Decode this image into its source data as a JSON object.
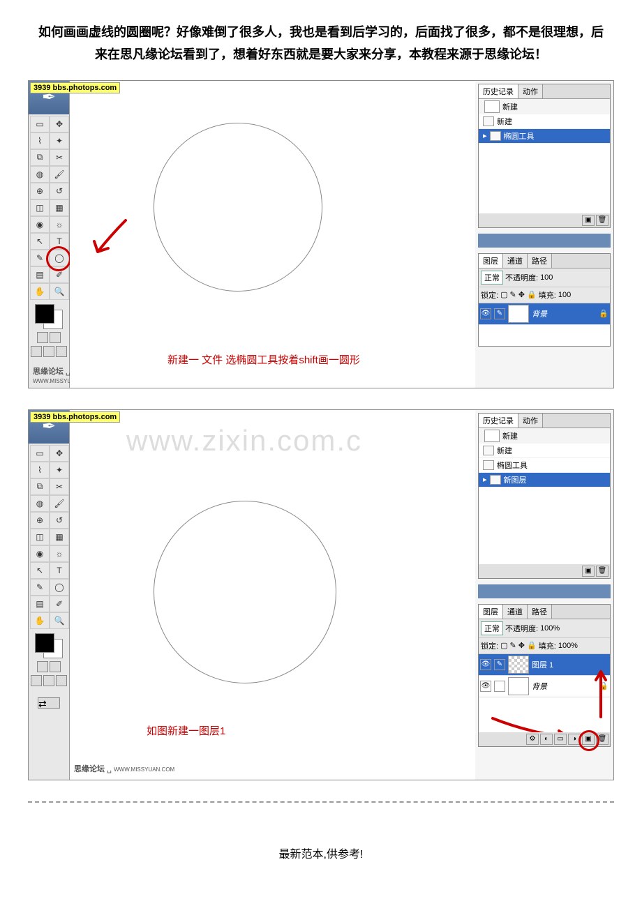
{
  "title_line1": "如何画画虚线的圆圈呢？好像难倒了很多人，我也是看到后学习的，后面找了很多，都不是很理想，后",
  "title_line2": "来在思凡缘论坛看到了，想着好东西就是要大家来分享，本教程来源于思缘论坛！",
  "watermark_tag_num": "3939",
  "watermark_tag_site": "bbs.photops.com",
  "big_watermark": "www.zixin.com.c",
  "footer_watermark_bold": "思缘论坛",
  "footer_watermark_url": "WWW.MISSYUAN.COM",
  "tabs": {
    "history": "历史记录",
    "actions": "动作",
    "layers": "图层",
    "channels": "通道",
    "paths": "路径"
  },
  "history1": {
    "doc": "新建",
    "items": [
      "新建",
      "椭圆工具"
    ]
  },
  "history2": {
    "doc": "新建",
    "items": [
      "新建",
      "椭圆工具",
      "新图层"
    ]
  },
  "layers1": {
    "blend": "正常",
    "opacity_label": "不透明度:",
    "opacity_val": "100",
    "lock_label": "锁定:",
    "fill_label": "填充:",
    "fill_val": "100",
    "bg": "背景"
  },
  "layers2": {
    "blend": "正常",
    "opacity_label": "不透明度:",
    "opacity_val": "100%",
    "lock_label": "锁定:",
    "fill_label": "填充:",
    "fill_val": "100%",
    "layer1": "图层 1",
    "bg": "背景"
  },
  "annotation1": "新建一 文件 选椭圆工具按着shift画一圆形",
  "annotation2": "如图新建一图层1",
  "footer_text": "最新范本,供参考!"
}
